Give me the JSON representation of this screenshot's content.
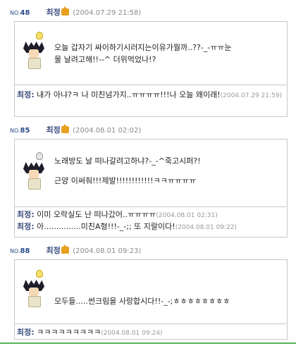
{
  "posts": [
    {
      "no_label": "NO.",
      "no_value": "48",
      "author": "최정",
      "date": "(2004.07.29 21:58)",
      "lines": [
        "오늘 갑자기 싸이하기시러지는이유가뭘까..??-_-ㅠㅠ눈",
        "물 날려고해!!--^ 더위먹었나!?"
      ],
      "comments": [
        {
          "who": "최정:",
          "text": " 내가 아냐?ㅋ 나 미친넘가지..ㅠㅠㅠㅠ!!!나 오늘 왜이래!",
          "date": "(2004.07.29 21:59)"
        }
      ]
    },
    {
      "no_label": "NO.",
      "no_value": "85",
      "author": "최정",
      "date": "(2004.08.01 02:02)",
      "lines": [
        "노래방도 날 떠나갈려고하냐?-_-^죽고시퍼?!",
        "",
        "근양 이써줘!!!제발!!!!!!!!!!!!ㅋㅋㅠㅠㅠㅠ"
      ],
      "comments": [
        {
          "who": "최정:",
          "text": " 이미 오락실도 난 떠나갔어..ㅠㅠㅠㅠ",
          "date": "(2004.08.01 02:31)"
        },
        {
          "who": "최정:",
          "text": " 아...............미친A형!!!-_-;; 또 지랄이다!",
          "date": "(2004.08.01 09:22)"
        }
      ]
    },
    {
      "no_label": "NO.",
      "no_value": "88",
      "author": "최정",
      "date": "(2004.08.01 09:23)",
      "lines": [
        "모두들.....썬크림을 사랑합시다!!-_-;ㅎㅎㅎㅎㅎㅎㅎㅎ"
      ],
      "comments": [
        {
          "who": "최정:",
          "text": " ㅋㅋㅋㅋㅋㅋㅋㅋㅋ",
          "date": "(2004.08.01 09:24)"
        }
      ]
    }
  ],
  "colors": {
    "author": "#3b4f7f",
    "date": "#8b8b8b",
    "border": "#c8c8c8",
    "accent_line": "#59b35c"
  },
  "icons": [
    "crown-icon",
    "lightbulb-icon",
    "avatar-character"
  ]
}
